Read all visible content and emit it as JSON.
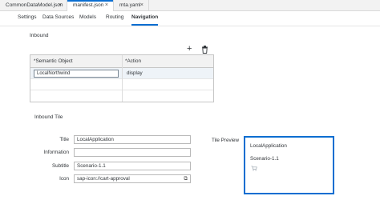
{
  "file_tabs": [
    {
      "label": "CommonDataModel.json",
      "active": false
    },
    {
      "label": "manifest.json",
      "active": true
    },
    {
      "label": "mta.yaml",
      "active": false
    }
  ],
  "editor_tabs": [
    "Settings",
    "Data Sources",
    "Models",
    "Routing",
    "Navigation"
  ],
  "inbound": {
    "title": "Inbound",
    "columns": [
      "*Semantic Object",
      "*Action"
    ],
    "rows": [
      {
        "semantic_object": "LocalNorthwind",
        "action": "display"
      }
    ]
  },
  "tile": {
    "title": "Inbound Tile",
    "fields": {
      "title_label": "Title",
      "title_value": "LocalApplication",
      "information_label": "Information",
      "information_value": "",
      "subtitle_label": "Subtitle",
      "subtitle_value": "Scenario-1.1",
      "icon_label": "Icon",
      "icon_value": "sap-icon://cart-approval"
    },
    "preview_label": "Tile Preview",
    "preview": {
      "title": "LocalApplication",
      "subtitle": "Scenario-1.1"
    }
  },
  "accent_color": "#0a6ed1"
}
